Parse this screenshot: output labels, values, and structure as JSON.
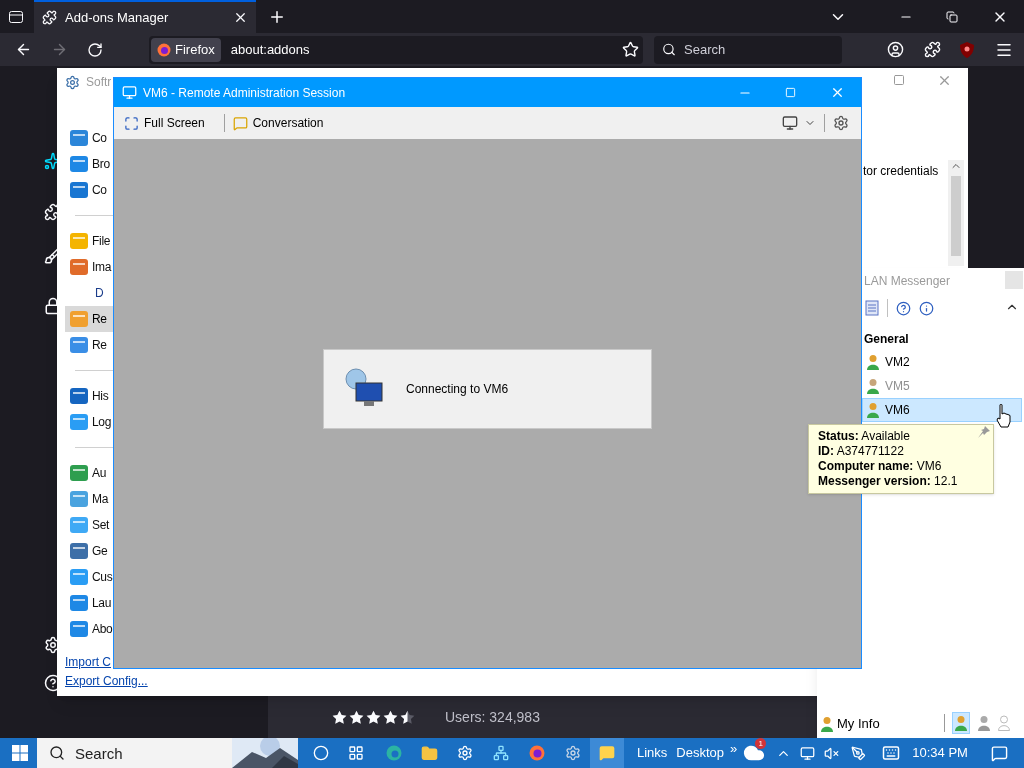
{
  "browser": {
    "tabs": [
      {
        "title": "Add-ons Manager",
        "selected": true
      }
    ],
    "identity": "Firefox",
    "url": "about:addons",
    "search": {
      "placeholder": "Search"
    },
    "addon": {
      "stars": 4.5,
      "users": "Users: 324,983"
    }
  },
  "softros": {
    "title": "Softr",
    "groups": [
      [
        {
          "kind": "item",
          "label": "Co",
          "selected": false
        },
        {
          "kind": "item",
          "label": "Bro",
          "selected": false
        },
        {
          "kind": "item",
          "label": "Co",
          "selected": false
        }
      ],
      [
        {
          "kind": "item",
          "label": "File",
          "selected": false
        },
        {
          "kind": "item",
          "label": "Ima",
          "selected": false
        },
        {
          "kind": "header",
          "label": "D"
        },
        {
          "kind": "item",
          "label": "Re",
          "selected": true
        },
        {
          "kind": "item",
          "label": "Re",
          "selected": false
        }
      ],
      [
        {
          "kind": "item",
          "label": "His",
          "selected": false
        },
        {
          "kind": "item",
          "label": "Log",
          "selected": false
        }
      ],
      [
        {
          "kind": "item",
          "label": "Au",
          "selected": false
        },
        {
          "kind": "item",
          "label": "Ma",
          "selected": false
        },
        {
          "kind": "item",
          "label": "Set",
          "selected": false
        },
        {
          "kind": "item",
          "label": "Ge",
          "selected": false
        },
        {
          "kind": "item",
          "label": "Cus",
          "selected": false
        },
        {
          "kind": "item",
          "label": "Lau",
          "selected": false
        },
        {
          "kind": "item",
          "label": "Abo",
          "selected": false
        }
      ]
    ],
    "side_text": "tor credentials",
    "links": [
      "Import C",
      "Export Config..."
    ]
  },
  "session": {
    "title": "VM6 - Remote Administration Session",
    "toolbar": [
      "Full Screen",
      "Conversation"
    ],
    "status": "Connecting to VM6"
  },
  "messenger": {
    "title": "LAN Messenger",
    "group": "General",
    "contacts": [
      {
        "name": "VM2",
        "greyed": false,
        "selected": false
      },
      {
        "name": "VM5",
        "greyed": true,
        "selected": false
      },
      {
        "name": "VM6",
        "greyed": false,
        "selected": true
      }
    ],
    "my_info": "My Info"
  },
  "tooltip": {
    "lines": [
      "**Status:** Available",
      "**ID:** A374771122",
      "**Computer name:** VM6",
      "**Messenger version:** 12.1"
    ]
  },
  "taskbar": {
    "search": {
      "placeholder": "Search"
    },
    "toolbars": [
      "Links",
      "Desktop"
    ],
    "more": "»",
    "badge": "1",
    "clock": "10:34 PM"
  }
}
